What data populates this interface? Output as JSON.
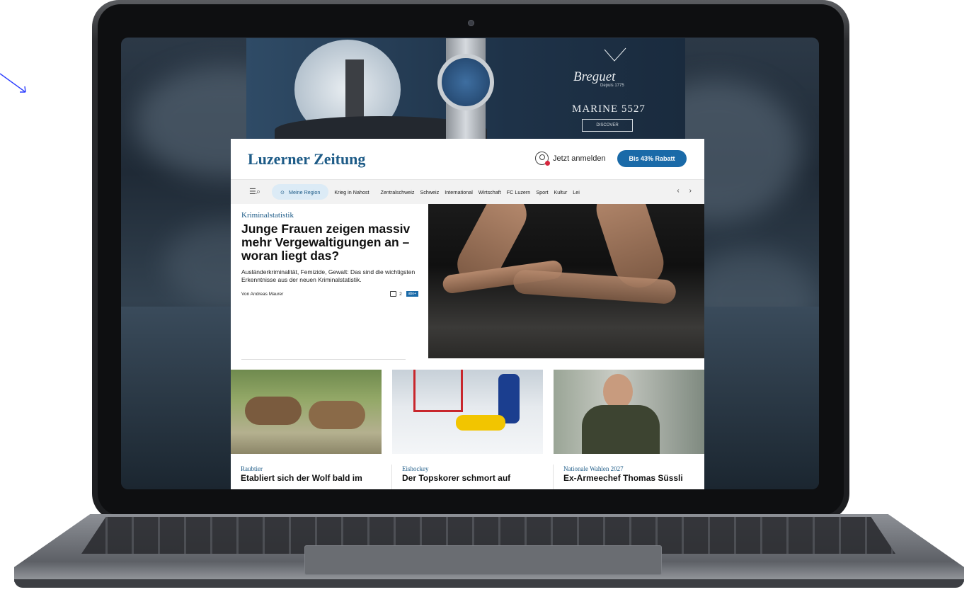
{
  "ad": {
    "brand": "Breguet",
    "brand_sub": "Depuis 1775",
    "model": "MARINE 5527",
    "cta": "DISCOVER"
  },
  "site": {
    "logo": "Luzerner Zeitung",
    "login_label": "Jetzt anmelden",
    "rabatt_label": "Bis 43% Rabatt",
    "nav": {
      "region": "Meine Region",
      "items": [
        "Krieg in Nahost",
        "Zentralschweiz",
        "Schweiz",
        "International",
        "Wirtschaft",
        "FC Luzern",
        "Sport",
        "Kultur",
        "Lei"
      ]
    },
    "hero": {
      "kicker": "Kriminalstatistik",
      "headline": "Junge Frauen zeigen massiv mehr Vergewaltigungen an – woran liegt das?",
      "teaser": "Ausländerkriminalität, Femizide, Gewalt: Das sind die wichtigsten Erkenntnisse aus der neuen Kriminalstatistik.",
      "author": "Von Andreas Maurer",
      "comments": "2",
      "abo": "abo+"
    },
    "cards": [
      {
        "kicker": "Raubtier",
        "title": "Etabliert sich der Wolf bald im"
      },
      {
        "kicker": "Eishockey",
        "title": "Der Topskorer schmort auf"
      },
      {
        "kicker": "Nationale Wahlen 2027",
        "title": "Ex-Armeechef Thomas Süssli"
      }
    ]
  },
  "colors": {
    "accent": "#1d5b87",
    "button": "#1a6aa8",
    "highlight": "#fff200"
  }
}
